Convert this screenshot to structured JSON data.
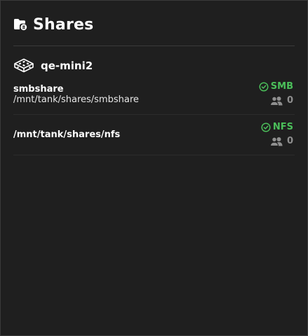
{
  "header": {
    "title": "Shares",
    "icon": "folder-share-icon"
  },
  "host": {
    "name": "qe-mini2",
    "icon": "server-icon"
  },
  "shares": [
    {
      "name": "smbshare",
      "path": "/mnt/tank/shares/smbshare",
      "protocol": "SMB",
      "status_icon": "check-circle-icon",
      "user_count": "0"
    },
    {
      "name": "/mnt/tank/shares/nfs",
      "protocol": "NFS",
      "status_icon": "check-circle-icon",
      "user_count": "0"
    }
  ],
  "colors": {
    "background": "#1f1f1f",
    "protocol_ok": "#4bbf5a",
    "muted": "#8f8f8f",
    "text": "#ffffff"
  }
}
